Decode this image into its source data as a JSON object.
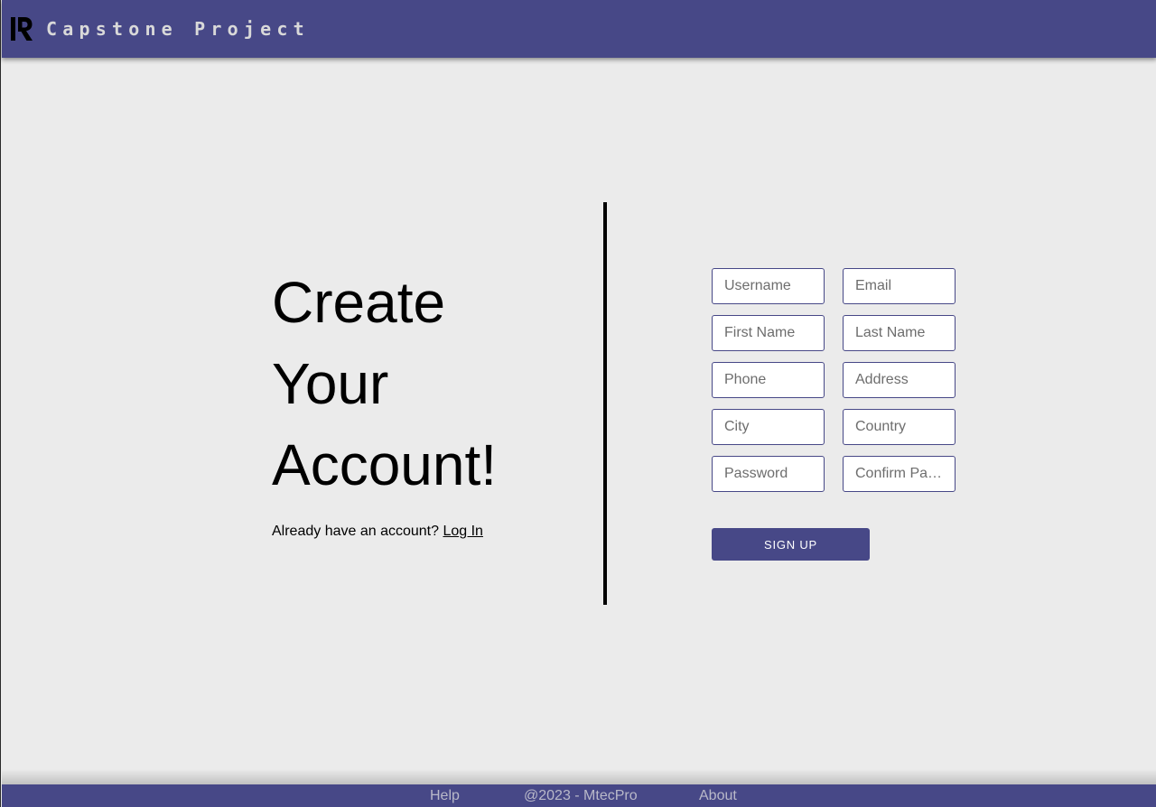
{
  "header": {
    "brand": "Capstone Project",
    "logo_icon": "r-logo-icon",
    "bar_color": "#474887"
  },
  "hero": {
    "line1": "Create",
    "line2": "Your",
    "line3": "Account!",
    "login_prompt": "Already have an account?",
    "login_link": "Log In"
  },
  "form": {
    "fields": [
      {
        "placeholder": "Username",
        "value": ""
      },
      {
        "placeholder": "Email",
        "value": ""
      },
      {
        "placeholder": "First Name",
        "value": ""
      },
      {
        "placeholder": "Last Name",
        "value": ""
      },
      {
        "placeholder": "Phone",
        "value": ""
      },
      {
        "placeholder": "Address",
        "value": ""
      },
      {
        "placeholder": "City",
        "value": ""
      },
      {
        "placeholder": "Country",
        "value": ""
      },
      {
        "placeholder": "Password",
        "value": ""
      },
      {
        "placeholder": "Confirm Password",
        "value": ""
      }
    ],
    "submit_label": "SIGN UP"
  },
  "footer": {
    "help": "Help",
    "copyright": "@2023 - MtecPro",
    "about": "About"
  }
}
